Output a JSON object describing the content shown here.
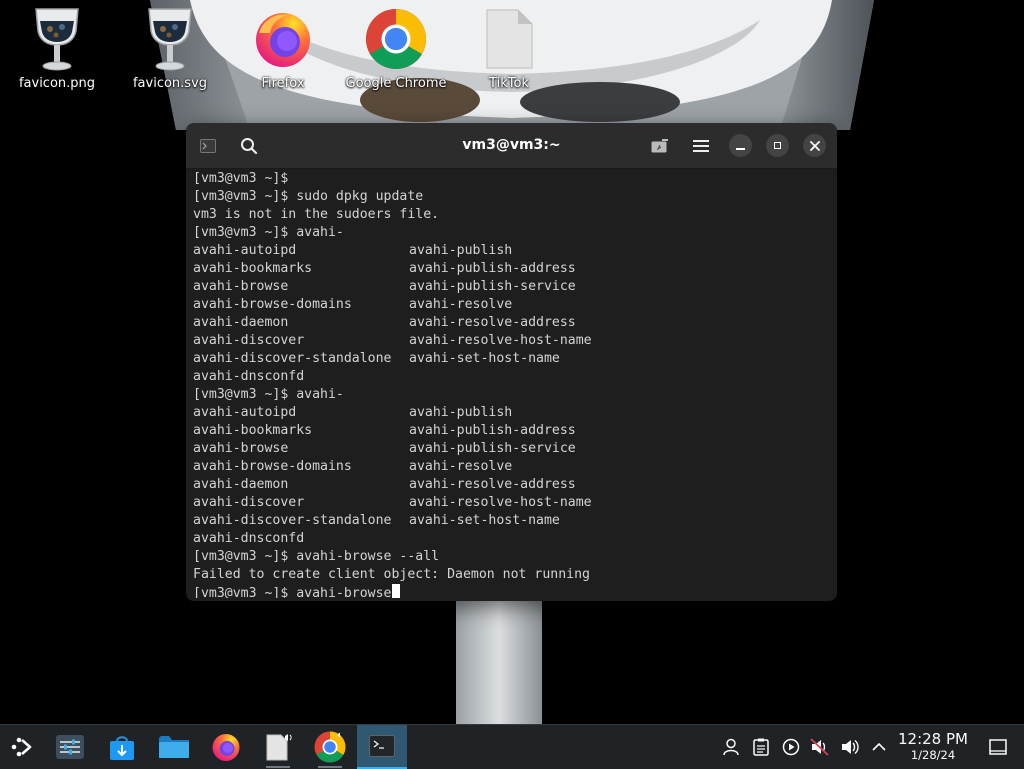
{
  "desktop": {
    "icons": [
      {
        "label": "favicon.png",
        "icon": "wine-glass-image-icon"
      },
      {
        "label": "favicon.svg",
        "icon": "wine-glass-image-icon"
      },
      {
        "label": "Firefox",
        "icon": "firefox-icon"
      },
      {
        "label": "Google Chrome",
        "icon": "chrome-icon"
      },
      {
        "label": "TikTok",
        "icon": "blank-file-icon"
      }
    ]
  },
  "terminal": {
    "title": "vm3@vm3:~",
    "header_icons": [
      "terminal-icon",
      "search-icon",
      "new-tab-icon",
      "menu-icon",
      "minimize-icon",
      "maximize-icon",
      "close-icon"
    ],
    "lines": [
      {
        "text": "[vm3@vm3 ~]$ "
      },
      {
        "text": "[vm3@vm3 ~]$ sudo dpkg update"
      },
      {
        "text": "vm3 is not in the sudoers file."
      },
      {
        "text": "[vm3@vm3 ~]$ avahi-"
      },
      {
        "c1": "avahi-autoipd",
        "c2": "avahi-publish"
      },
      {
        "c1": "avahi-bookmarks",
        "c2": "avahi-publish-address"
      },
      {
        "c1": "avahi-browse",
        "c2": "avahi-publish-service"
      },
      {
        "c1": "avahi-browse-domains",
        "c2": "avahi-resolve"
      },
      {
        "c1": "avahi-daemon",
        "c2": "avahi-resolve-address"
      },
      {
        "c1": "avahi-discover",
        "c2": "avahi-resolve-host-name"
      },
      {
        "c1": "avahi-discover-standalone",
        "c2": "avahi-set-host-name"
      },
      {
        "text": "avahi-dnsconfd"
      },
      {
        "text": "[vm3@vm3 ~]$ avahi-"
      },
      {
        "c1": "avahi-autoipd",
        "c2": "avahi-publish"
      },
      {
        "c1": "avahi-bookmarks",
        "c2": "avahi-publish-address"
      },
      {
        "c1": "avahi-browse",
        "c2": "avahi-publish-service"
      },
      {
        "c1": "avahi-browse-domains",
        "c2": "avahi-resolve"
      },
      {
        "c1": "avahi-daemon",
        "c2": "avahi-resolve-address"
      },
      {
        "c1": "avahi-discover",
        "c2": "avahi-resolve-host-name"
      },
      {
        "c1": "avahi-discover-standalone",
        "c2": "avahi-set-host-name"
      },
      {
        "text": "avahi-dnsconfd"
      },
      {
        "text": "[vm3@vm3 ~]$ avahi-browse --all"
      },
      {
        "text": "Failed to create client object: Daemon not running"
      },
      {
        "text": "[vm3@vm3 ~]$ avahi-browse",
        "cursor": true
      }
    ]
  },
  "taskbar": {
    "items": [
      {
        "name": "application-launcher",
        "icon": "kde-launcher-icon"
      },
      {
        "name": "system-settings",
        "icon": "settings-sliders-icon"
      },
      {
        "name": "discover-store",
        "icon": "store-bag-icon"
      },
      {
        "name": "file-manager",
        "icon": "folder-icon"
      },
      {
        "name": "firefox",
        "icon": "firefox-icon"
      },
      {
        "name": "tiktok-file",
        "icon": "blank-file-audio-icon"
      },
      {
        "name": "google-chrome",
        "icon": "chrome-icon"
      },
      {
        "name": "terminal",
        "icon": "terminal-icon",
        "active": true
      }
    ],
    "tray": [
      "user-icon",
      "clipboard-icon",
      "media-play-icon",
      "muted-speaker-icon",
      "volume-icon",
      "chevron-up-icon"
    ],
    "clock": {
      "time": "12:28 PM",
      "date": "1/28/24"
    },
    "show_desktop_icon": "show-desktop-icon"
  },
  "colors": {
    "terminal_bg": "#1e1e1e",
    "terminal_header": "#2c2c2c",
    "terminal_text": "#d4d4d4",
    "taskbar_bg": "#1f2326",
    "taskbar_active": "#2f5872",
    "accent": "#3daee9"
  }
}
